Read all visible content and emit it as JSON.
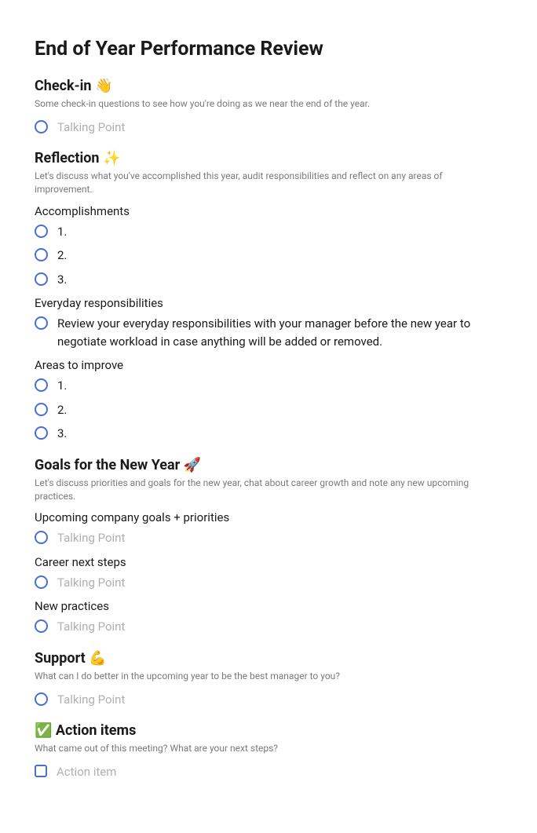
{
  "pageTitle": "End of Year Performance Review",
  "sections": {
    "checkin": {
      "title": "Check-in 👋",
      "desc": "Some check-in questions to see how you're doing as we near the end of the year.",
      "placeholder": "Talking Point"
    },
    "reflection": {
      "title": "Reflection ✨",
      "desc": "Let's discuss what you've accomplished this year, audit responsibilities and reflect on any areas of improvement.",
      "accomplishments": {
        "label": "Accomplishments",
        "items": [
          "1.",
          "2.",
          "3."
        ]
      },
      "responsibilities": {
        "label": "Everyday responsibilities",
        "text": "Review your everyday responsibilities with your manager before the new year to negotiate workload in case anything will be added or removed."
      },
      "improve": {
        "label": "Areas to improve",
        "items": [
          "1.",
          "2.",
          "3."
        ]
      }
    },
    "goals": {
      "title": "Goals for the New Year 🚀",
      "desc": "Let's discuss priorities and goals for the new year, chat about career growth and note any new upcoming practices.",
      "upcoming": {
        "label": "Upcoming company goals + priorities",
        "placeholder": "Talking Point"
      },
      "career": {
        "label": "Career next steps",
        "placeholder": "Talking Point"
      },
      "practices": {
        "label": "New practices",
        "placeholder": "Talking Point"
      }
    },
    "support": {
      "title": "Support 💪",
      "desc": "What can I do better in the upcoming year to be the best manager to you?",
      "placeholder": "Talking Point"
    },
    "action": {
      "title": "✅ Action items",
      "desc": "What came out of this meeting? What are your next steps?",
      "placeholder": "Action item"
    }
  }
}
